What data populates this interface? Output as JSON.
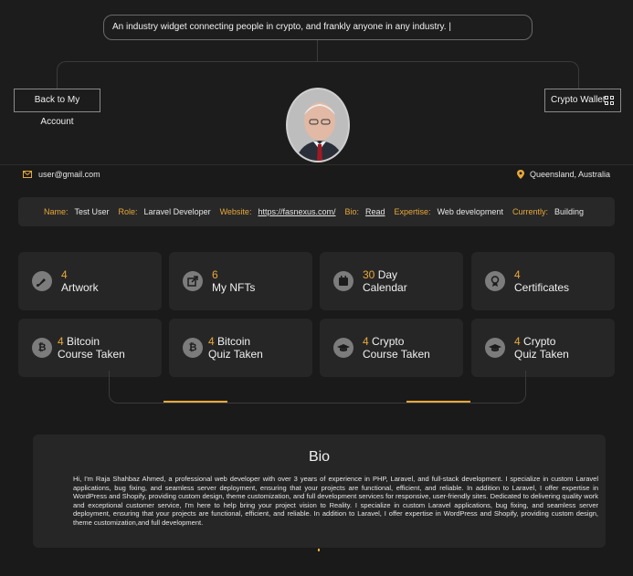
{
  "header": {
    "tagline": "An industry widget connecting people in crypto, and frankly anyone in any industry. |",
    "back_button": "Back to My Account",
    "wallet_button": "Crypto Wallet",
    "avatar_icon": "profile-photo"
  },
  "contact": {
    "email": "user@gmail.com",
    "location": "Queensland, Australia"
  },
  "profile_info": {
    "name_label": "Name:",
    "name": "Test User",
    "role_label": "Role:",
    "role": "Laravel Developer",
    "website_label": "Website:",
    "website": "https://fasnexus.com/",
    "bio_label": "Bio:",
    "bio": "Read",
    "expertise_label": "Expertise:",
    "expertise": "Web development",
    "currently_label": "Currently:",
    "currently": "Building"
  },
  "cards": [
    {
      "count": "4",
      "line1": "Artwork",
      "line2": "",
      "icon": "brush-icon"
    },
    {
      "count": "6",
      "line1": "My NFTs",
      "line2": "",
      "icon": "external-link-icon"
    },
    {
      "count": "30",
      "line1": "Day",
      "line2": "Calendar",
      "icon": "calendar-icon"
    },
    {
      "count": "4",
      "line1": "Certificates",
      "line2": "",
      "icon": "award-icon"
    },
    {
      "count": "4",
      "line1": "Bitcoin",
      "line2": "Course Taken",
      "icon": "bitcoin-icon"
    },
    {
      "count": "4",
      "line1": "Bitcoin",
      "line2": "Quiz Taken",
      "icon": "bitcoin-icon"
    },
    {
      "count": "4",
      "line1": "Crypto",
      "line2": "Course Taken",
      "icon": "graduation-cap-icon"
    },
    {
      "count": "4",
      "line1": "Crypto",
      "line2": "Quiz Taken",
      "icon": "graduation-cap-icon"
    }
  ],
  "bio_section": {
    "title": "Bio",
    "text": "Hi, I'm Raja Shahbaz Ahmed, a professional web developer with over 3 years of experience in PHP, Laravel, and full-stack development. I specialize in custom Laravel applications, bug fixing, and seamless server deployment, ensuring that your projects are functional, efficient, and reliable. In addition to Laravel, I offer expertise in WordPress and Shopify, providing custom design, theme customization, and full development services for responsive, user-friendly sites. Dedicated to delivering quality work and exceptional customer service, I'm here to help bring your project vision to Reality. I specialize in custom Laravel applications, bug fixing, and seamless server deployment, ensuring that your projects are functional, efficient, and reliable. In addition to Laravel, I offer expertise in WordPress and Shopify, providing custom design, theme customization,and full development."
  },
  "colors": {
    "accent": "#e8a83a",
    "background": "#1a1a1a",
    "card": "#262626"
  }
}
